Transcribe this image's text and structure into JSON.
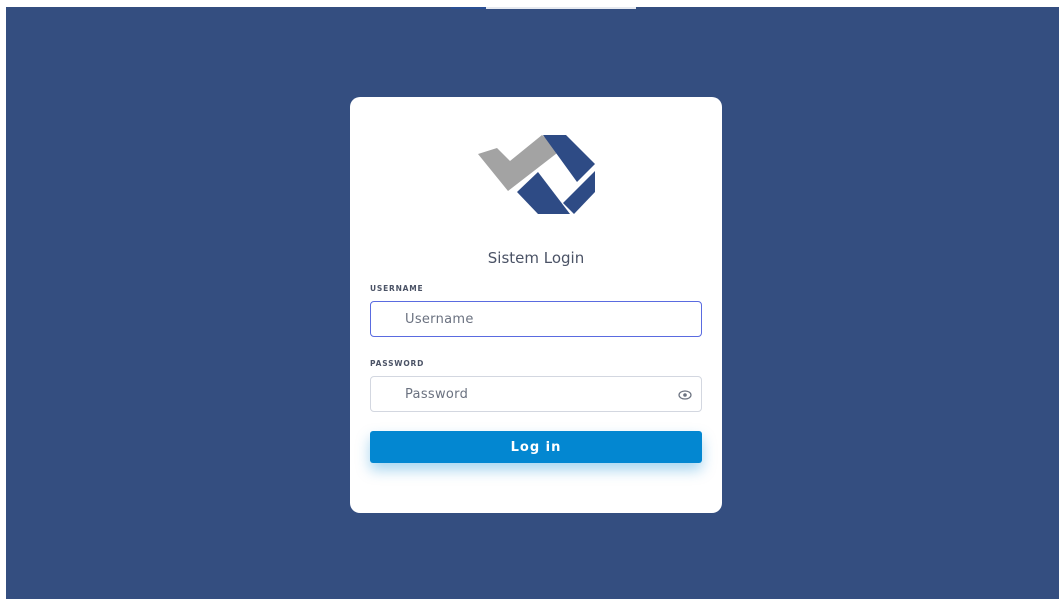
{
  "app": {
    "title": "Sistem Login"
  },
  "logo": {
    "name": "brand-logo",
    "colors": {
      "gray": "#a3a3a3",
      "navy": "#2e4b85"
    }
  },
  "form": {
    "username": {
      "label": "USERNAME",
      "placeholder": "Username",
      "value": ""
    },
    "password": {
      "label": "PASSWORD",
      "placeholder": "Password",
      "value": "",
      "toggle_icon": "eye-icon"
    },
    "submit_label": "Log in"
  },
  "colors": {
    "background": "#344e80",
    "card": "#ffffff",
    "accent": "#0387d1",
    "focus_border": "#5a6be0"
  }
}
